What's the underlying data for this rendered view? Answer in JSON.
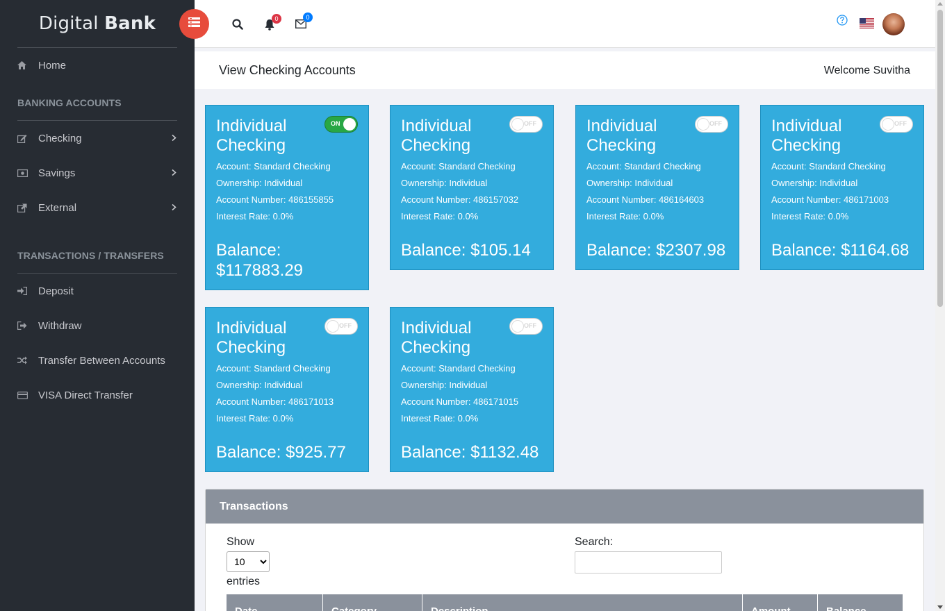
{
  "brand": {
    "light": "Digital",
    "bold": "Bank"
  },
  "sidebar": {
    "home": "Home",
    "section1": "BANKING ACCOUNTS",
    "accounts": [
      {
        "label": "Checking"
      },
      {
        "label": "Savings"
      },
      {
        "label": "External"
      }
    ],
    "section2": "TRANSACTIONS / TRANSFERS",
    "transactions": [
      {
        "label": "Deposit"
      },
      {
        "label": "Withdraw"
      },
      {
        "label": "Transfer Between Accounts"
      },
      {
        "label": "VISA Direct Transfer"
      }
    ]
  },
  "header": {
    "notifications_count": "0",
    "messages_count": "0"
  },
  "page": {
    "title": "View Checking Accounts",
    "welcome": "Welcome Suvitha"
  },
  "accounts": [
    {
      "title": "Individual Checking",
      "toggle": "ON",
      "account": "Account: Standard Checking",
      "ownership": "Ownership: Individual",
      "number": "Account Number: 486155855",
      "rate": "Interest Rate: 0.0%",
      "balance": "Balance: $117883.29"
    },
    {
      "title": "Individual Checking",
      "toggle": "OFF",
      "account": "Account: Standard Checking",
      "ownership": "Ownership: Individual",
      "number": "Account Number: 486157032",
      "rate": "Interest Rate: 0.0%",
      "balance": "Balance: $105.14"
    },
    {
      "title": "Individual Checking",
      "toggle": "OFF",
      "account": "Account: Standard Checking",
      "ownership": "Ownership: Individual",
      "number": "Account Number: 486164603",
      "rate": "Interest Rate: 0.0%",
      "balance": "Balance: $2307.98"
    },
    {
      "title": "Individual Checking",
      "toggle": "OFF",
      "account": "Account: Standard Checking",
      "ownership": "Ownership: Individual",
      "number": "Account Number: 486171003",
      "rate": "Interest Rate: 0.0%",
      "balance": "Balance: $1164.68"
    },
    {
      "title": "Individual Checking",
      "toggle": "OFF",
      "account": "Account: Standard Checking",
      "ownership": "Ownership: Individual",
      "number": "Account Number: 486171013",
      "rate": "Interest Rate: 0.0%",
      "balance": "Balance: $925.77"
    },
    {
      "title": "Individual Checking",
      "toggle": "OFF",
      "account": "Account: Standard Checking",
      "ownership": "Ownership: Individual",
      "number": "Account Number: 486171015",
      "rate": "Interest Rate: 0.0%",
      "balance": "Balance: $1132.48"
    }
  ],
  "transactions": {
    "title": "Transactions",
    "show_label": "Show",
    "show_value": "10",
    "entries_label": "entries",
    "search_label": "Search:",
    "columns": [
      "Date",
      "Category",
      "Description",
      "Amount",
      "Balance"
    ]
  },
  "colors": {
    "accent": "#e74c3c",
    "card": "#33acdd",
    "sidebar": "#272c33",
    "toggle_on": "#28a745"
  }
}
